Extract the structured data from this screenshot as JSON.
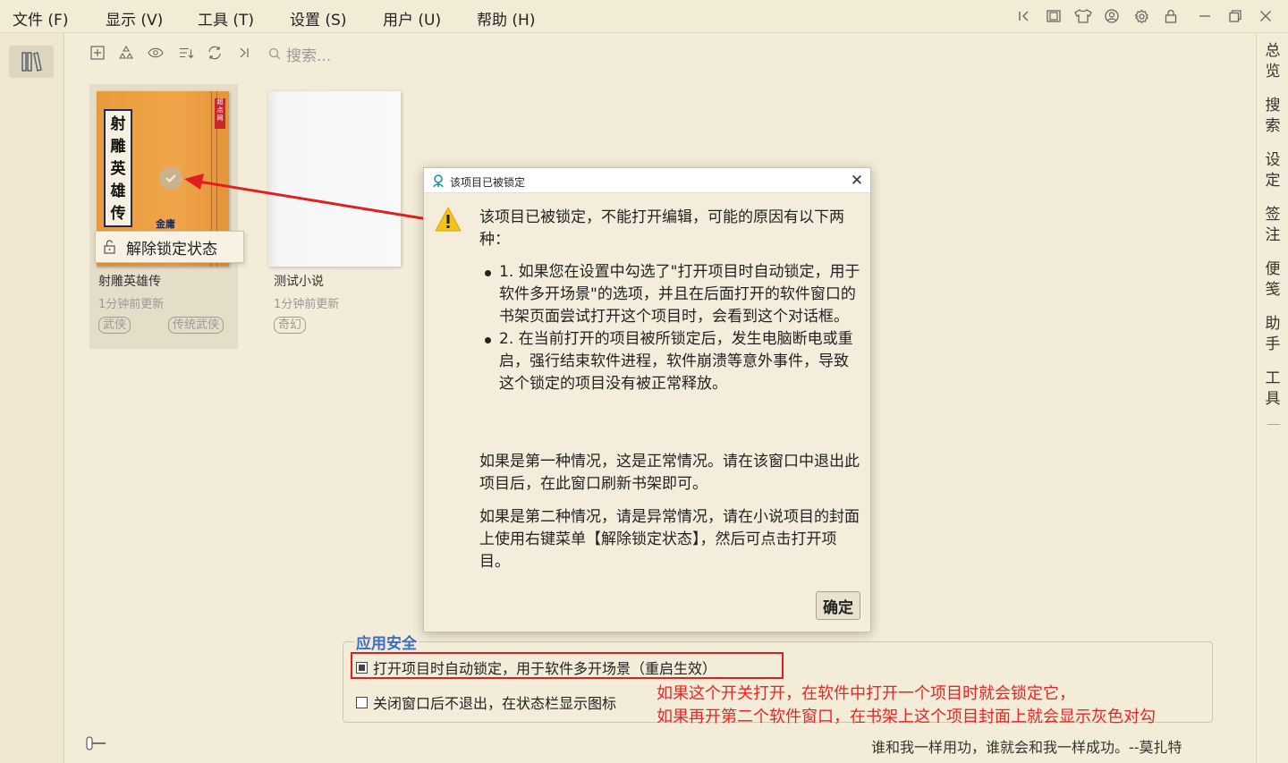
{
  "menubar": {
    "items": [
      "文件 (F)",
      "显示 (V)",
      "工具 (T)",
      "设置 (S)",
      "用户 (U)",
      "帮助 (H)"
    ]
  },
  "window_controls": {
    "icons": [
      "collapse-left-icon",
      "layout-icon",
      "shirt-icon",
      "user-icon",
      "settings-icon",
      "lock-icon",
      "minimize-icon",
      "restore-icon",
      "close-icon"
    ]
  },
  "toolbar": {
    "icons": [
      "add-icon",
      "recycle-icon",
      "eye-icon",
      "sort-icon",
      "refresh-icon",
      "collapse-icon"
    ],
    "search_placeholder": "搜索..."
  },
  "right_sidebar": {
    "items": [
      "总\n览",
      "搜\n索",
      "设\n定",
      "签\n注",
      "便\n笺",
      "助\n手",
      "工\n具"
    ]
  },
  "books": [
    {
      "title": "射雕英雄传",
      "time": "1分钟前更新",
      "tags": [
        "武侠",
        "传统武侠"
      ],
      "cover_title": [
        "射",
        "雕",
        "英",
        "雄",
        "传"
      ],
      "cover_tag": "超点网",
      "cover_author": "金庸",
      "cover_color": "#ef9e42"
    },
    {
      "title": "测试小说",
      "time": "1分钟前更新",
      "tags": [
        "奇幻"
      ]
    }
  ],
  "context_menu": {
    "label": "解除锁定状态"
  },
  "dialog": {
    "title": "该项目已被锁定",
    "intro": "该项目已被锁定，不能打开编辑，可能的原因有以下两种：",
    "reasons": [
      "1. 如果您在设置中勾选了\"打开项目时自动锁定，用于软件多开场景\"的选项，并且在后面打开的软件窗口的书架页面尝试打开这个项目时，会看到这个对话框。",
      "2. 在当前打开的项目被所锁定后，发生电脑断电或重启，强行结束软件进程，软件崩溃等意外事件，导致这个锁定的项目没有被正常释放。"
    ],
    "para1": "如果是第一种情况，这是正常情况。请在该窗口中退出此项目后，在此窗口刷新书架即可。",
    "para2": "如果是第二种情况，请是异常情况，请在小说项目的封面上使用右键菜单【解除锁定状态】，然后可点击打开项目。",
    "ok_label": "确定"
  },
  "settings": {
    "group_title": "应用安全",
    "option1": "打开项目时自动锁定，用于软件多开场景（重启生效）",
    "option1_checked": true,
    "option2": "关闭窗口后不退出，在状态栏显示图标",
    "option2_checked": false
  },
  "annotation": {
    "line1": "如果这个开关打开，在软件中打开一个项目时就会锁定它，",
    "line2": "如果再开第二个软件窗口，在书架上这个项目封面上就会显示灰色对勾",
    "color": "#ee2222"
  },
  "status": {
    "quote": "谁和我一样用功，谁就会和我一样成功。--莫扎特"
  },
  "colors": {
    "background": "#f3ecd8",
    "accent": "#3b6cc8",
    "highlight": "#e02020"
  }
}
